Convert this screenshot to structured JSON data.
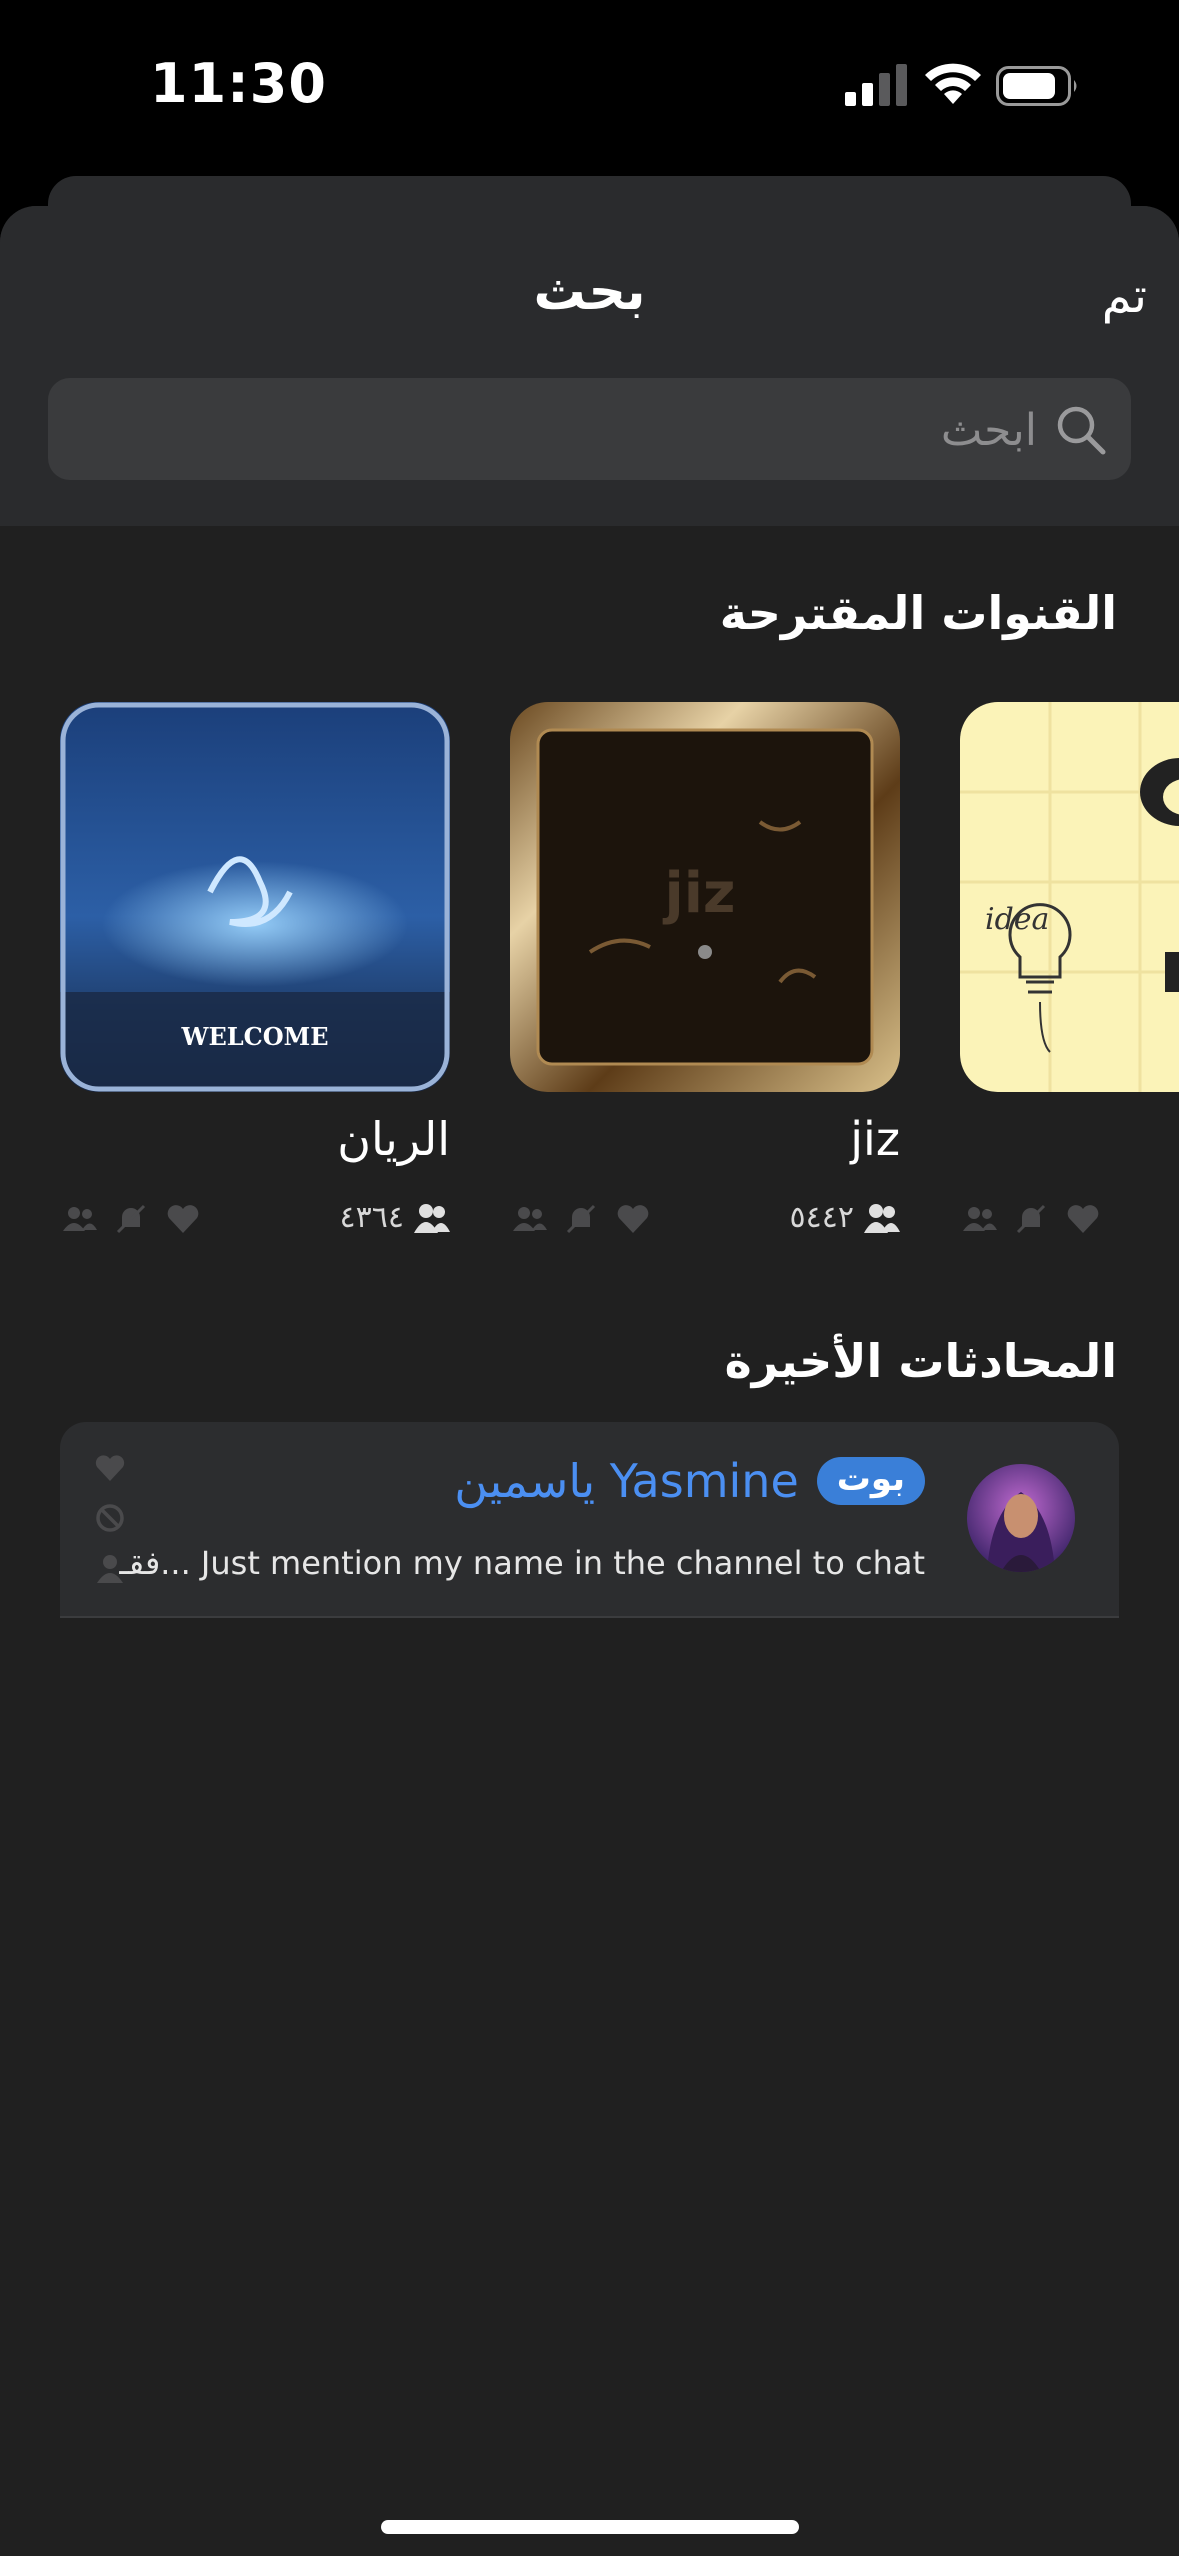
{
  "status_bar": {
    "time": "11:30",
    "signal_icon": "cellular-signal-icon",
    "wifi_icon": "wifi-icon",
    "battery_icon": "battery-icon"
  },
  "header": {
    "title": "بحث",
    "done_label": "تم"
  },
  "search": {
    "placeholder": "ابحث",
    "value": "",
    "icon": "search-icon"
  },
  "suggested": {
    "title": "القنوات المقترحة",
    "channels": [
      {
        "name": "الريان",
        "members": "٤٣٦٤",
        "thumb_text": "WELCOME"
      },
      {
        "name": "jiz",
        "members": "٥٤٤٢"
      },
      {
        "name": "",
        "members": "",
        "thumb_text": "idea"
      }
    ]
  },
  "recent": {
    "title": "المحادثات الأخيرة",
    "chats": [
      {
        "badge": "بوت",
        "name": "Yasmine ياسمين",
        "preview": "فقـ... Just mention my name in the channel to chat"
      }
    ]
  },
  "colors": {
    "accent": "#3a7fd8",
    "link": "#4b8ff2",
    "sheet": "#202020",
    "header": "#2a2b2d"
  }
}
